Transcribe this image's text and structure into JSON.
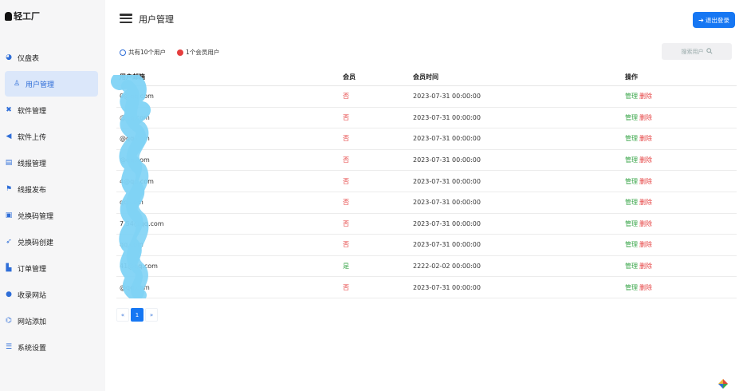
{
  "brand": {
    "name": "轻工厂"
  },
  "sidebar": {
    "items": [
      {
        "label": "仪盘表",
        "icon": "palette-icon",
        "glyph": "◕",
        "color": "#2f6ed8"
      },
      {
        "label": "用户管理",
        "icon": "user-icon",
        "glyph": "♙",
        "color": "#2f6ed8"
      },
      {
        "label": "软件管理",
        "icon": "tools-icon",
        "glyph": "✖",
        "color": "#2f6ed8"
      },
      {
        "label": "软件上传",
        "icon": "send-icon",
        "glyph": "◀",
        "color": "#2f6ed8"
      },
      {
        "label": "线报管理",
        "icon": "list-icon",
        "glyph": "▤",
        "color": "#2f6ed8"
      },
      {
        "label": "线报发布",
        "icon": "flag-icon",
        "glyph": "⚑",
        "color": "#2f6ed8"
      },
      {
        "label": "兑换码管理",
        "icon": "gift-icon",
        "glyph": "▣",
        "color": "#2f6ed8"
      },
      {
        "label": "兑换码创建",
        "icon": "pin-icon",
        "glyph": "➶",
        "color": "#2f6ed8"
      },
      {
        "label": "订单管理",
        "icon": "book-icon",
        "glyph": "▙",
        "color": "#2f6ed8"
      },
      {
        "label": "收录网站",
        "icon": "globe-icon",
        "glyph": "●",
        "color": "#2f6ed8"
      },
      {
        "label": "网站添加",
        "icon": "link-icon",
        "glyph": "⌬",
        "color": "#2f6ed8"
      },
      {
        "label": "系统设置",
        "icon": "settings-icon",
        "glyph": "☰",
        "color": "#2f6ed8"
      }
    ],
    "active_index": 1
  },
  "header": {
    "title": "用户管理",
    "logout_label": "退出登录"
  },
  "summary": {
    "total_users": "共有10个用户",
    "member_users": "1个会员用户"
  },
  "search": {
    "placeholder": "搜索用户"
  },
  "table": {
    "columns": [
      "用户邮箱",
      "会员",
      "会员时间",
      "操作"
    ],
    "rows": [
      {
        "email": "0@qq.com",
        "member": "否",
        "member_time": "2023-07-31 00:00:00"
      },
      {
        "email": "@qq.com",
        "member": "否",
        "member_time": "2023-07-31 00:00:00"
      },
      {
        "email": "@qq.com",
        "member": "否",
        "member_time": "2023-07-31 00:00:00"
      },
      {
        "email": "@qq.com",
        "member": "否",
        "member_time": "2023-07-31 00:00:00"
      },
      {
        "email": "4@qq.com",
        "member": "否",
        "member_time": "2023-07-31 00:00:00"
      },
      {
        "email": "qq.com",
        "member": "否",
        "member_time": "2023-07-31 00:00:00"
      },
      {
        "email": "7 54@qq.com",
        "member": "否",
        "member_time": "2023-07-31 00:00:00"
      },
      {
        "email": "qq.com",
        "member": "否",
        "member_time": "2023-07-31 00:00:00"
      },
      {
        "email": "41@qq.com",
        "member": "是",
        "member_time": "2222-02-02 00:00:00"
      },
      {
        "email": "@qq.com",
        "member": "否",
        "member_time": "2023-07-31 00:00:00"
      }
    ],
    "action_manage": "管理",
    "action_delete": "删除"
  },
  "pagination": {
    "prev": "«",
    "current": "1",
    "next": "»"
  },
  "colors": {
    "accent": "#1677f3",
    "danger": "#e53e3e",
    "success": "#3aa64a",
    "sidebar_bg": "#f6f6f7"
  }
}
